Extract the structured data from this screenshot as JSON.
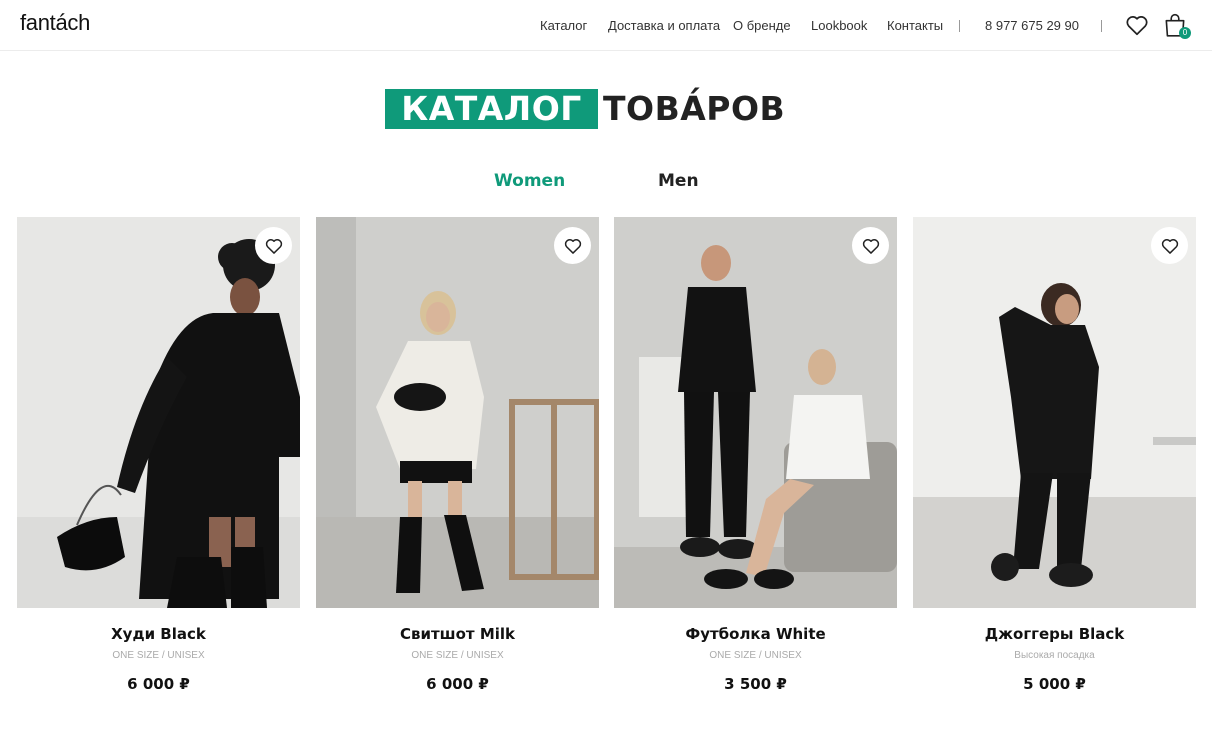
{
  "header": {
    "logo": "fantách",
    "nav": [
      "Каталог",
      "Доставка и оплата",
      "О бренде",
      "Lookbook",
      "Контакты"
    ],
    "phone": "8 977 675 29 90",
    "cart_count": "0"
  },
  "title": {
    "accent": "КАТАЛОГ",
    "rest": "ТОВА́РОВ"
  },
  "tabs": [
    {
      "label": "Women",
      "active": true
    },
    {
      "label": "Men",
      "active": false
    }
  ],
  "products": [
    {
      "name": "Худи Black",
      "subtitle": "ONE SIZE / UNISEX",
      "price": "6 000 ₽"
    },
    {
      "name": "Свитшот Milk",
      "subtitle": "ONE SIZE / UNISEX",
      "price": "6 000 ₽"
    },
    {
      "name": "Футболка White",
      "subtitle": "ONE SIZE / UNISEX",
      "price": "3 500 ₽"
    },
    {
      "name": "Джоггеры Black",
      "subtitle": "Высокая посадка",
      "price": "5 000 ₽"
    }
  ],
  "colors": {
    "accent": "#0f9a7a",
    "text": "#111111",
    "muted": "#aaaaaa"
  }
}
